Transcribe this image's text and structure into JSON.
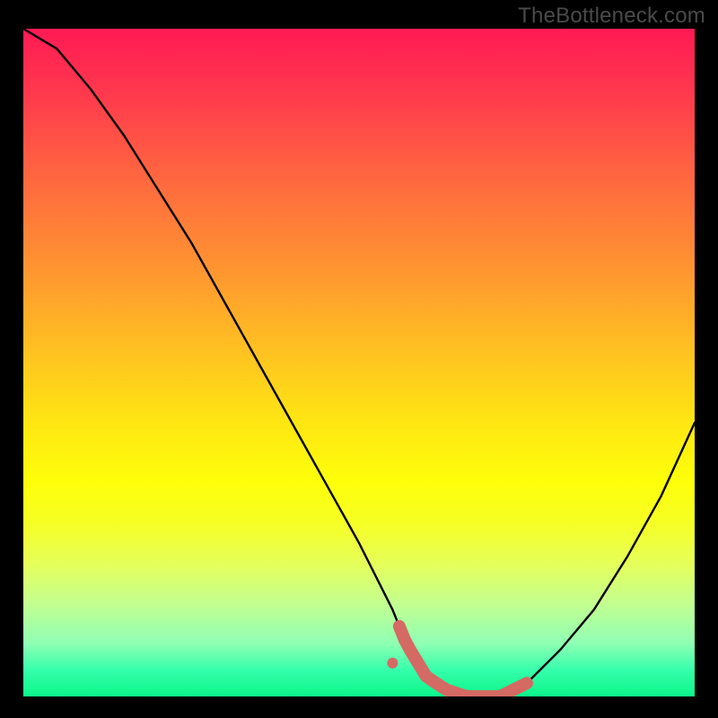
{
  "watermark": "TheBottleneck.com",
  "colors": {
    "frame_bg": "#000000",
    "curve": "#000000",
    "highlight": "#d46a63"
  },
  "chart_data": {
    "type": "line",
    "title": "",
    "xlabel": "",
    "ylabel": "",
    "xlim": [
      0,
      100
    ],
    "ylim": [
      0,
      100
    ],
    "grid": false,
    "background_gradient": [
      "#ff1a54",
      "#feff0a",
      "#0cf58a"
    ],
    "series": [
      {
        "name": "bottleneck-curve",
        "x": [
          0,
          5,
          10,
          15,
          20,
          25,
          30,
          35,
          40,
          45,
          50,
          55,
          57,
          60,
          63,
          66,
          68,
          71,
          75,
          80,
          85,
          90,
          95,
          100
        ],
        "y": [
          100,
          97,
          91,
          84,
          76,
          68,
          59,
          50,
          41,
          32,
          23,
          13,
          8,
          3,
          1,
          0,
          0,
          0,
          2,
          7,
          13,
          21,
          30,
          41
        ]
      }
    ],
    "annotations": [
      {
        "name": "optimal-range",
        "x_range": [
          56,
          75
        ],
        "y": 0,
        "style": "thick-rounded",
        "color": "#d46a63"
      },
      {
        "name": "optimal-dot",
        "x": 55,
        "y": 5,
        "style": "dot",
        "color": "#d46a63"
      }
    ]
  }
}
